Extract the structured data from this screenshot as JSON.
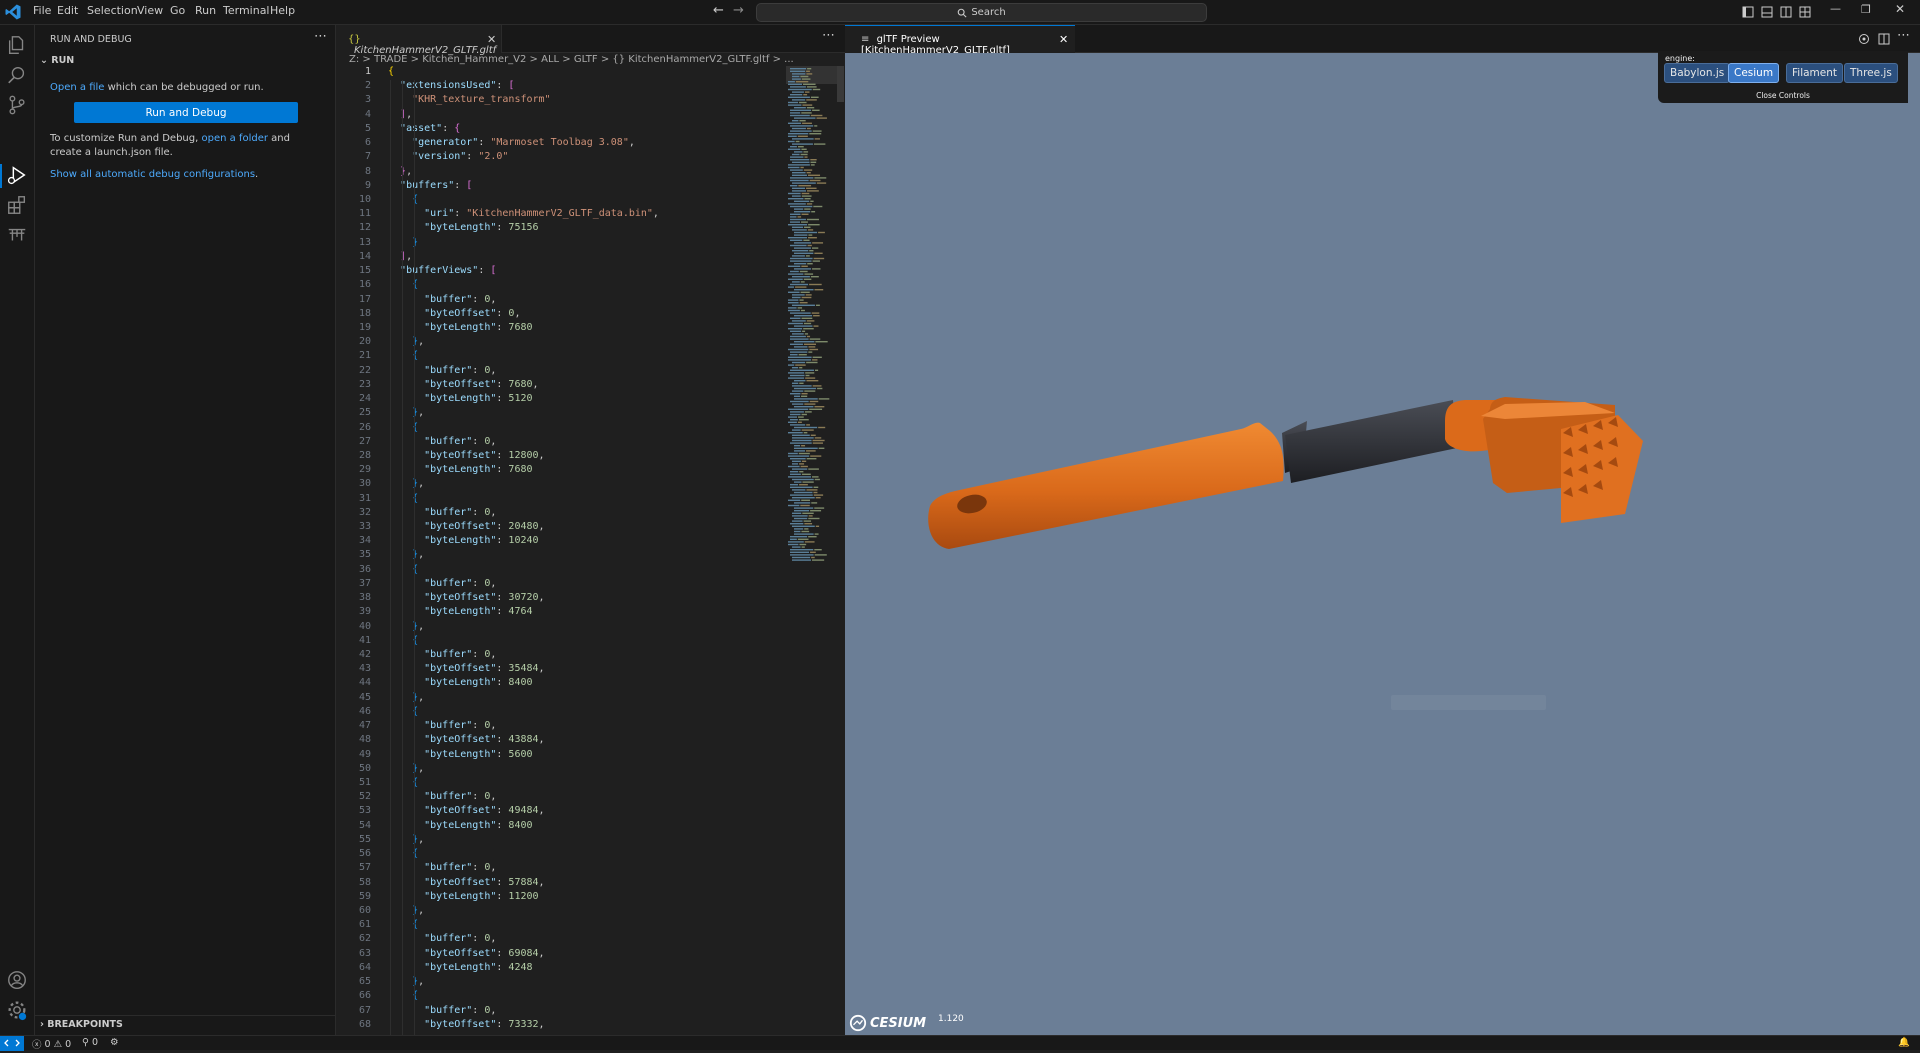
{
  "menu": [
    "File",
    "Edit",
    "Selection",
    "View",
    "Go",
    "Run",
    "Terminal",
    "Help"
  ],
  "search": {
    "label": "Search"
  },
  "sidebar": {
    "title": "RUN AND DEBUG",
    "run_header": "RUN",
    "open_link": "Open a file",
    "open_rest": " which can be debugged or run.",
    "run_button": "Run and Debug",
    "customize_pre": "To customize Run and Debug, ",
    "customize_link": "open a folder",
    "customize_post": " and create a launch.json file.",
    "show_all": "Show all automatic debug configurations",
    "show_all_dot": ".",
    "breakpoints": "BREAKPOINTS"
  },
  "editor": {
    "tab_label": "KitchenHammerV2_GLTF.gltf",
    "breadcrumb": "Z: > TRADE > Kitchen_Hammer_V2 > ALL > GLTF > {} KitchenHammerV2_GLTF.gltf > ...",
    "code_lines": [
      "{",
      "  \"extensionsUsed\": [",
      "    \"KHR_texture_transform\"",
      "  ],",
      "  \"asset\": {",
      "    \"generator\": \"Marmoset Toolbag 3.08\",",
      "    \"version\": \"2.0\"",
      "  },",
      "  \"buffers\": [",
      "    {",
      "      \"uri\": \"KitchenHammerV2_GLTF_data.bin\",",
      "      \"byteLength\": 75156",
      "    }",
      "  ],",
      "  \"bufferViews\": [",
      "    {",
      "      \"buffer\": 0,",
      "      \"byteOffset\": 0,",
      "      \"byteLength\": 7680",
      "    },",
      "    {",
      "      \"buffer\": 0,",
      "      \"byteOffset\": 7680,",
      "      \"byteLength\": 5120",
      "    },",
      "    {",
      "      \"buffer\": 0,",
      "      \"byteOffset\": 12800,",
      "      \"byteLength\": 7680",
      "    },",
      "    {",
      "      \"buffer\": 0,",
      "      \"byteOffset\": 20480,",
      "      \"byteLength\": 10240",
      "    },",
      "    {",
      "      \"buffer\": 0,",
      "      \"byteOffset\": 30720,",
      "      \"byteLength\": 4764",
      "    },",
      "    {",
      "      \"buffer\": 0,",
      "      \"byteOffset\": 35484,",
      "      \"byteLength\": 8400",
      "    },",
      "    {",
      "      \"buffer\": 0,",
      "      \"byteOffset\": 43884,",
      "      \"byteLength\": 5600",
      "    },",
      "    {",
      "      \"buffer\": 0,",
      "      \"byteOffset\": 49484,",
      "      \"byteLength\": 8400",
      "    },",
      "    {",
      "      \"buffer\": 0,",
      "      \"byteOffset\": 57884,",
      "      \"byteLength\": 11200",
      "    },",
      "    {",
      "      \"buffer\": 0,",
      "      \"byteOffset\": 69084,",
      "      \"byteLength\": 4248",
      "    },",
      "    {",
      "      \"buffer\": 0,",
      "      \"byteOffset\": 73332,"
    ]
  },
  "preview": {
    "tab_label": "glTF Preview [KitchenHammerV2_GLTF.gltf]",
    "engine_label": "engine:",
    "engines": [
      "Babylon.js",
      "Cesium",
      "Filament",
      "Three.js"
    ],
    "active_engine": "Cesium",
    "close_controls": "Close Controls",
    "logo_text": "CESIUM",
    "version": "1.120"
  },
  "status": {
    "errors": "0",
    "warnings": "0",
    "ports": "0"
  },
  "colors": {
    "accent": "#0078d4",
    "viewport_bg": "#6b7e96",
    "hammer": "#e0701c"
  }
}
